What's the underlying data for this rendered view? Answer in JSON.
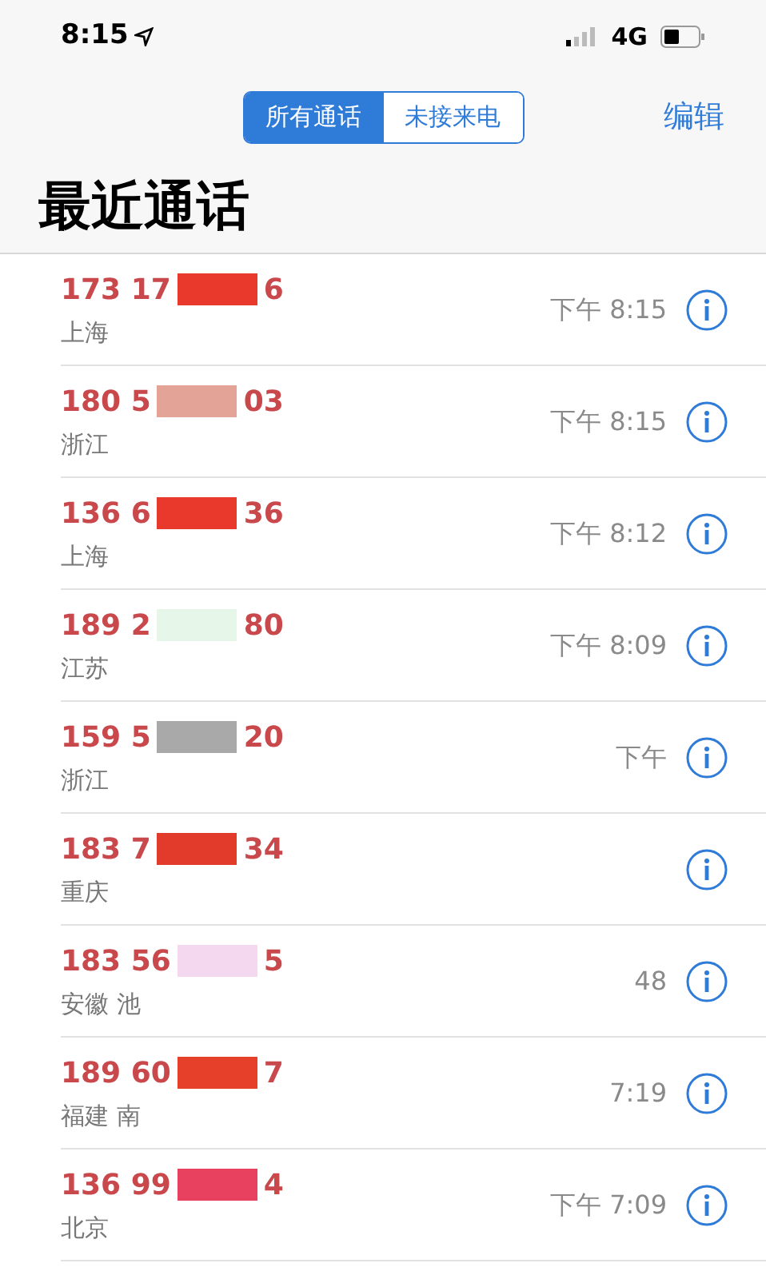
{
  "status_bar": {
    "time": "8:15",
    "network": "4G"
  },
  "nav": {
    "segments": [
      {
        "label": "所有通话",
        "selected": true
      },
      {
        "label": "未接来电",
        "selected": false
      }
    ],
    "edit": "编辑"
  },
  "title": "最近通话",
  "calls": [
    {
      "number_start": "173 17",
      "number_end": "6",
      "location": "上海",
      "time": "下午 8:15",
      "color": "#e8392c"
    },
    {
      "number_start": "180 5",
      "number_end": "03",
      "location": "浙江",
      "time": "下午 8:15",
      "color": "#e3a497"
    },
    {
      "number_start": "136 6",
      "number_end": "36",
      "location": "上海",
      "time": "下午 8:12",
      "color": "#e8392c"
    },
    {
      "number_start": "189 2",
      "number_end": "80",
      "location": "江苏",
      "time": "下午 8:09",
      "color": "#e6f7ea"
    },
    {
      "number_start": "159 5",
      "number_end": "20",
      "location": "浙江",
      "time": "下午",
      "color": "#a9a9a9"
    },
    {
      "number_start": "183 7",
      "number_end": "34",
      "location": "重庆",
      "color": "#e23b2c"
    },
    {
      "number_start": "183 56",
      "number_end": "5",
      "location": "安徽 池",
      "time": "48",
      "color": "#f3d8f0"
    },
    {
      "number_start": "189 60",
      "number_end": "7",
      "location": "福建 南",
      "time": "7:19",
      "color": "#e6402b"
    },
    {
      "number_start": "136 99",
      "number_end": "4",
      "location": "北京",
      "time": "下午 7:09",
      "color": "#e8415f"
    }
  ]
}
